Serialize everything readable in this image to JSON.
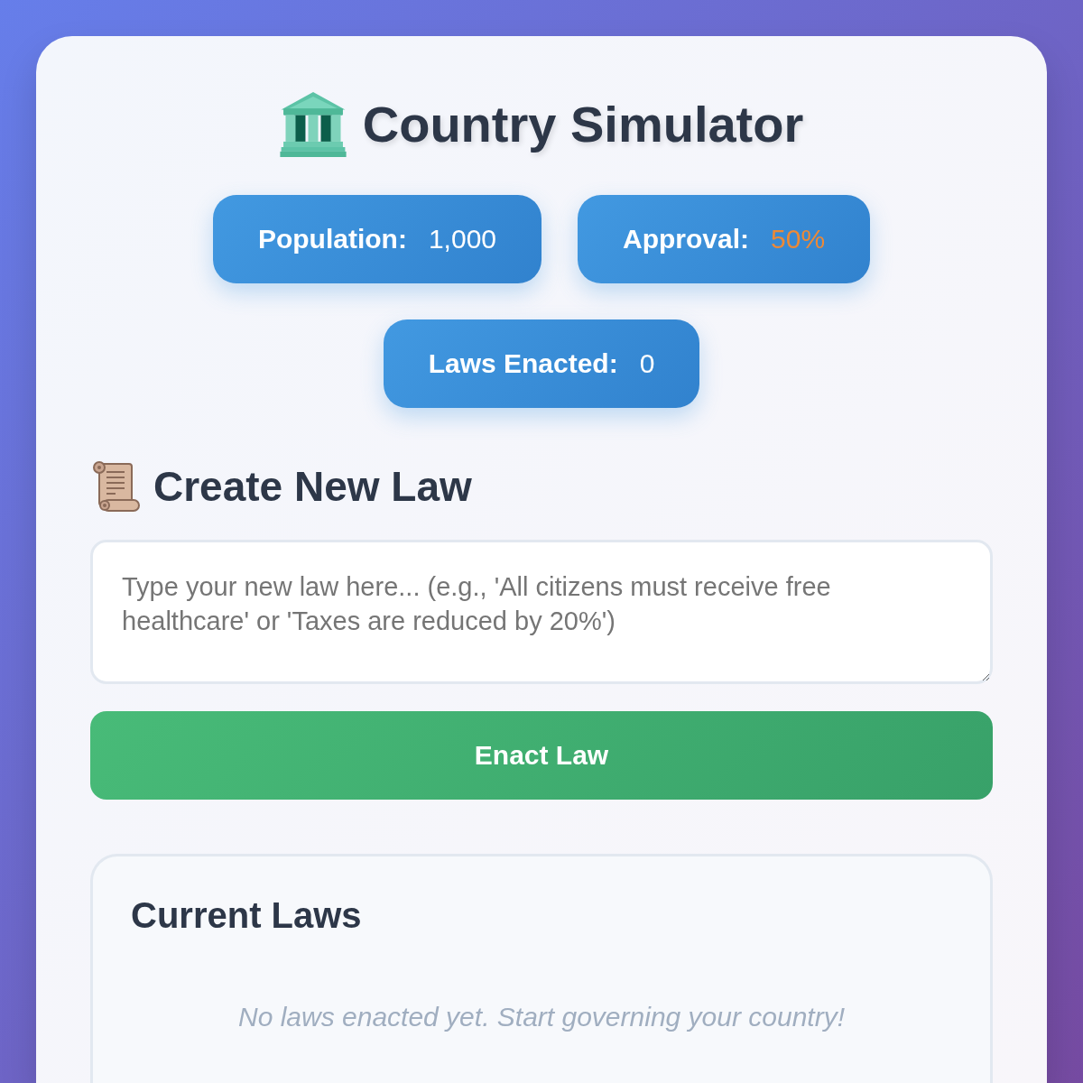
{
  "title": {
    "text": "Country Simulator"
  },
  "stats": [
    {
      "label": "Population:",
      "value": "1,000",
      "color": "#ffffff"
    },
    {
      "label": "Approval:",
      "value": "50%",
      "color": "#ed8936"
    },
    {
      "label": "Laws Enacted:",
      "value": "0",
      "color": "#ffffff"
    }
  ],
  "law_form": {
    "heading": "Create New Law",
    "input": {
      "placeholder": "Type your new law here... (e.g., 'All citizens must receive free healthcare' or 'Taxes are reduced by 20%')"
    },
    "button": "Enact Law"
  },
  "current_laws": {
    "heading": "Current Laws",
    "empty_message": "No laws enacted yet. Start governing your country!"
  }
}
